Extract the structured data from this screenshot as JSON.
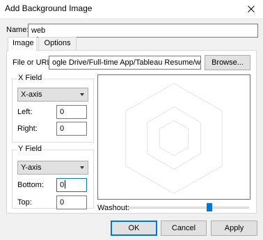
{
  "window": {
    "title": "Add Background Image"
  },
  "name": {
    "label": "Name:",
    "value": "web"
  },
  "tabs": [
    {
      "label": "Image"
    },
    {
      "label": "Options"
    }
  ],
  "file": {
    "label": "File or URL:",
    "value": "ogle Drive/Full-time App/Tableau Resume/web.jpg",
    "browse_label": "Browse..."
  },
  "x_field": {
    "title": "X Field",
    "selected": "X-axis",
    "left_label": "Left:",
    "left_value": "0",
    "right_label": "Right:",
    "right_value": "0"
  },
  "y_field": {
    "title": "Y Field",
    "selected": "Y-axis",
    "bottom_label": "Bottom:",
    "bottom_value": "0",
    "top_label": "Top:",
    "top_value": "0"
  },
  "washout": {
    "label": "Washout:",
    "value_fraction": 0.68
  },
  "buttons": {
    "ok": "OK",
    "cancel": "Cancel",
    "apply": "Apply"
  }
}
